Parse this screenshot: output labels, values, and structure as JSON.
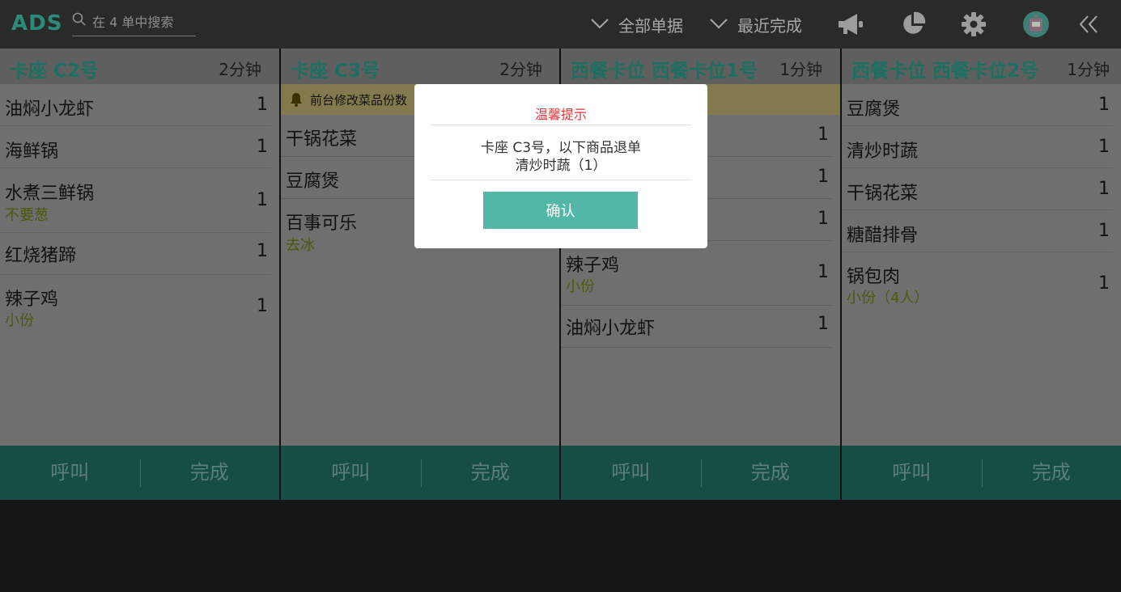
{
  "app": {
    "logo": "ADS"
  },
  "search": {
    "placeholder": "在 4 单中搜索"
  },
  "filters": {
    "all_orders": "全部单据",
    "recent_done": "最近完成"
  },
  "toolbar_icons": [
    "megaphone-icon",
    "pie-chart-icon",
    "gear-icon",
    "avatar-icon",
    "collapse-icon"
  ],
  "colors": {
    "accent": "#52b7a6",
    "title_teal": "#1d6f62",
    "alert_red": "#e0393e",
    "note_olive": "#4a5a0a"
  },
  "columns": [
    {
      "title": "卡座 C2号",
      "time": "2分钟",
      "items": [
        {
          "name": "油焖小龙虾",
          "qty": "1",
          "note": ""
        },
        {
          "name": "海鲜锅",
          "qty": "1",
          "note": ""
        },
        {
          "name": "水煮三鲜锅",
          "qty": "1",
          "note": "不要葱"
        },
        {
          "name": "红烧猪蹄",
          "qty": "1",
          "note": ""
        },
        {
          "name": "辣子鸡",
          "qty": "1",
          "note": "小份"
        }
      ],
      "call_label": "呼叫",
      "done_label": "完成"
    },
    {
      "title": "卡座 C3号",
      "time": "2分钟",
      "notice": "前台修改菜品份数",
      "items": [
        {
          "name": "干锅花菜",
          "qty": "",
          "note": ""
        },
        {
          "name": "豆腐煲",
          "qty": "",
          "note": ""
        },
        {
          "name": "百事可乐",
          "qty": "",
          "note": "去冰"
        }
      ],
      "call_label": "呼叫",
      "done_label": "完成"
    },
    {
      "title": "西餐卡位 西餐卡位1号",
      "time": "1分钟",
      "items": [
        {
          "name": "",
          "qty": "1",
          "note": ""
        },
        {
          "name": "",
          "qty": "1",
          "note": ""
        },
        {
          "name": "",
          "qty": "1",
          "note": ""
        },
        {
          "name": "辣子鸡",
          "qty": "1",
          "note": "小份"
        },
        {
          "name": "油焖小龙虾",
          "qty": "1",
          "note": ""
        }
      ],
      "call_label": "呼叫",
      "done_label": "完成"
    },
    {
      "title": "西餐卡位 西餐卡位2号",
      "time": "1分钟",
      "items": [
        {
          "name": "豆腐煲",
          "qty": "1",
          "note": ""
        },
        {
          "name": "清炒时蔬",
          "qty": "1",
          "note": ""
        },
        {
          "name": "干锅花菜",
          "qty": "1",
          "note": ""
        },
        {
          "name": "糖醋排骨",
          "qty": "1",
          "note": ""
        },
        {
          "name": "锅包肉",
          "qty": "1",
          "note": "小份（4人）"
        }
      ],
      "call_label": "呼叫",
      "done_label": "完成"
    }
  ],
  "dialog": {
    "title": "温馨提示",
    "message_line1": "卡座 C3号，以下商品退单",
    "message_line2": "清炒时蔬（1）",
    "confirm_label": "确认"
  }
}
